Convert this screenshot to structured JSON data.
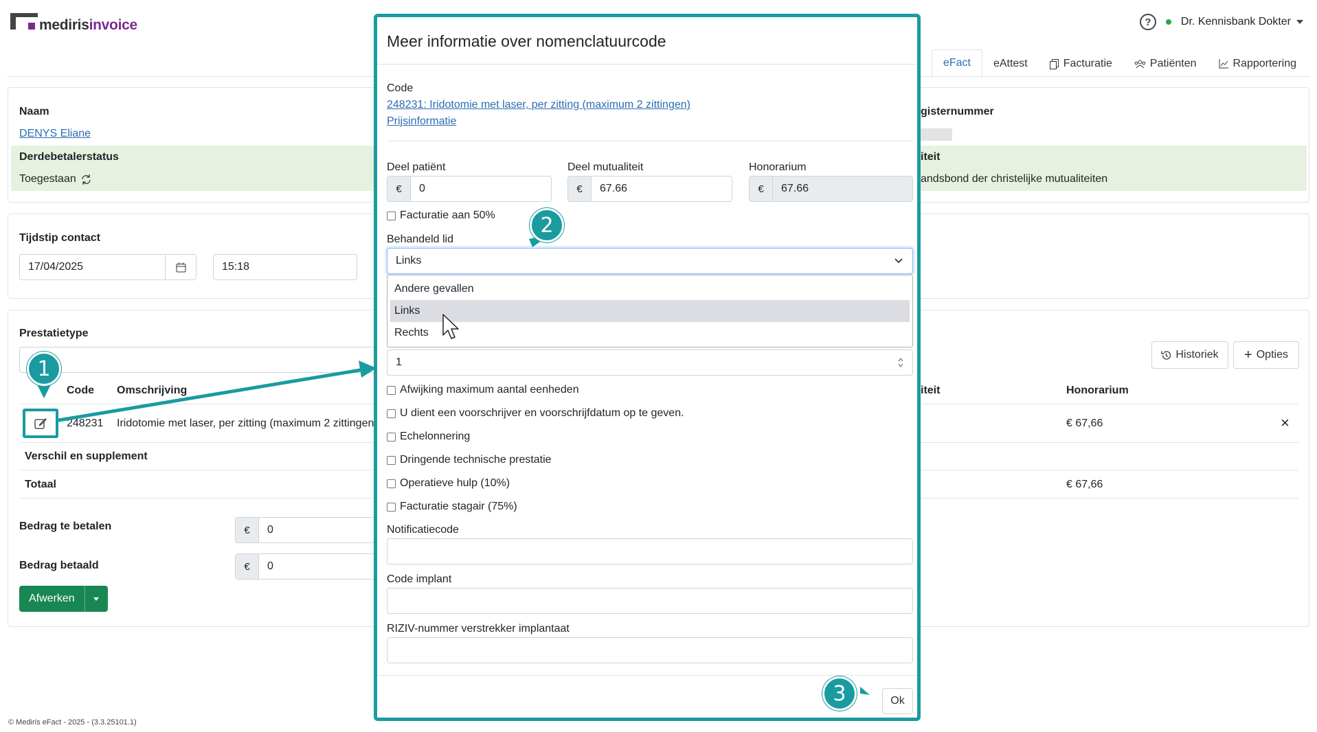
{
  "app": {
    "logo_part1": "mediris",
    "logo_part2": "invoice",
    "user": "Dr. Kennisbank Dokter",
    "help": "?"
  },
  "tabs": [
    {
      "label": "eFact",
      "icon": ""
    },
    {
      "label": "eAttest",
      "icon": ""
    },
    {
      "label": "Facturatie",
      "icon": "copy-icon"
    },
    {
      "label": "Patiënten",
      "icon": "users-icon"
    },
    {
      "label": "Rapportering",
      "icon": "chart-icon"
    }
  ],
  "patient": {
    "naam_label": "Naam",
    "naam_value": "DENYS Eliane",
    "derde_label": "Derdebetalerstatus",
    "derde_value": "Toegestaan",
    "register_label": "gisternummer",
    "mutual_label": "iteit",
    "mutual_value": "andsbond der christelijke mutualiteiten"
  },
  "contact": {
    "label": "Tijdstip contact",
    "date": "17/04/2025",
    "time": "15:18"
  },
  "prestatie": {
    "label": "Prestatietype",
    "historiek": "Historiek",
    "opties": "Opties",
    "col_code": "Code",
    "col_omschrijving": "Omschrijving",
    "col_mutual": "iteit",
    "col_honorarium": "Honorarium",
    "row_code": "248231",
    "row_desc": "Iridotomie met laser, per zitting (maximum 2 zittingen",
    "row_honorarium": "€ 67,66",
    "row_remove": "×",
    "verschil": "Verschil en supplement",
    "totaal": "Totaal",
    "totaal_value": "€ 67,66"
  },
  "payment": {
    "te_betalen_label": "Bedrag te betalen",
    "te_betalen_value": "0",
    "betaald_label": "Bedrag betaald",
    "betaald_value": "0",
    "currency": "€",
    "afwerken": "Afwerken"
  },
  "footer": "© Mediris eFact - 2025 - (3.3.25101.1)",
  "modal": {
    "title": "Meer informatie over nomenclatuurcode",
    "code_label": "Code",
    "code_link": "248231: Iridotomie met laser, per zitting (maximum 2 zittingen)",
    "prijs_link": "Prijsinformatie",
    "deel_patient_label": "Deel patiënt",
    "deel_patient_value": "0",
    "deel_mut_label": "Deel mutualiteit",
    "deel_mut_value": "67.66",
    "honorarium_label": "Honorarium",
    "honorarium_value": "67.66",
    "currency": "€",
    "fact50": "Facturatie aan 50%",
    "behandeld_label": "Behandeld lid",
    "behandeld_value": "Links",
    "dropdown_options": [
      "Andere gevallen",
      "Links",
      "Rechts"
    ],
    "units_value": "1",
    "checks": [
      "Afwijking maximum aantal eenheden",
      "U dient een voorschrijver en voorschrijfdatum op te geven.",
      "Echelonnering",
      "Dringende technische prestatie",
      "Operatieve hulp (10%)",
      "Facturatie stagair (75%)"
    ],
    "notificatie_label": "Notificatiecode",
    "implant_label": "Code implant",
    "riziv_label": "RIZIV-nummer verstrekker implantaat",
    "ok": "Ok"
  },
  "callouts": {
    "one": "1",
    "two": "2",
    "three": "3"
  },
  "colors": {
    "accent": "#1a9ba0",
    "link": "#2b6cb0",
    "green_row": "#e6f2df",
    "button_green": "#198754"
  }
}
